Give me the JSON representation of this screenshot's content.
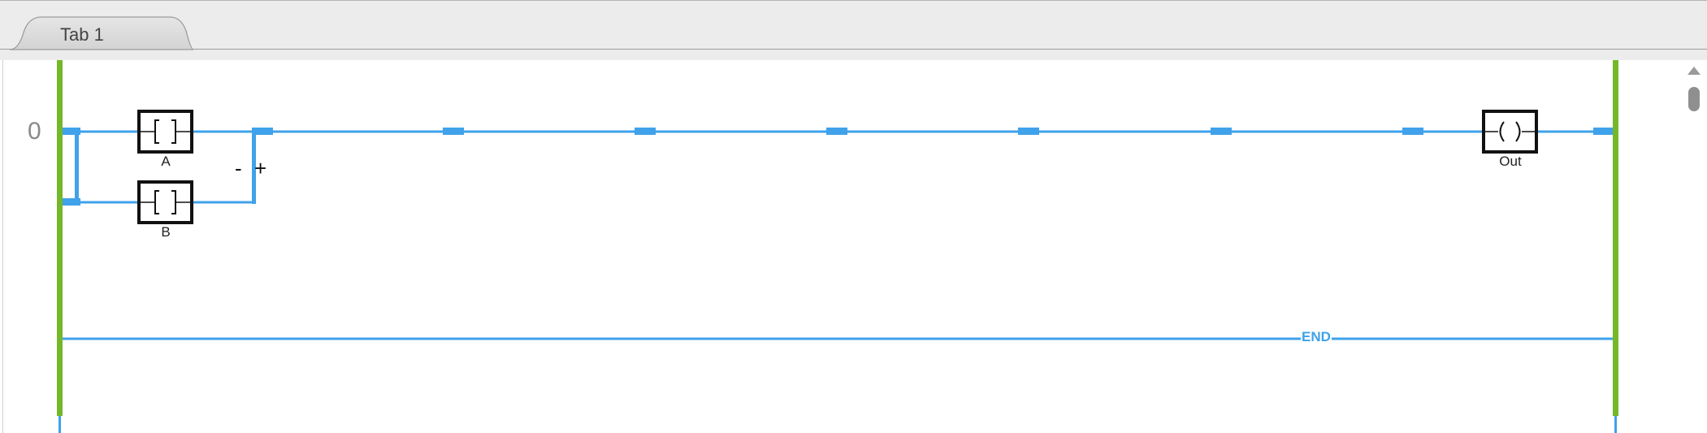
{
  "tabs": [
    {
      "label": "Tab 1"
    }
  ],
  "rung": {
    "number": "0",
    "contacts": [
      {
        "label": "A",
        "symbol": "[ ]"
      },
      {
        "label": "B",
        "symbol": "[ ]"
      }
    ],
    "coil": {
      "label": "Out",
      "symbol": "( )"
    },
    "branch": {
      "minus": "-",
      "plus": "+"
    }
  },
  "end_label": "END",
  "colors": {
    "power_rail": "#74b72a",
    "wire": "#3fa2ea",
    "element_border": "#111111",
    "tab_bar": "#ececec"
  }
}
